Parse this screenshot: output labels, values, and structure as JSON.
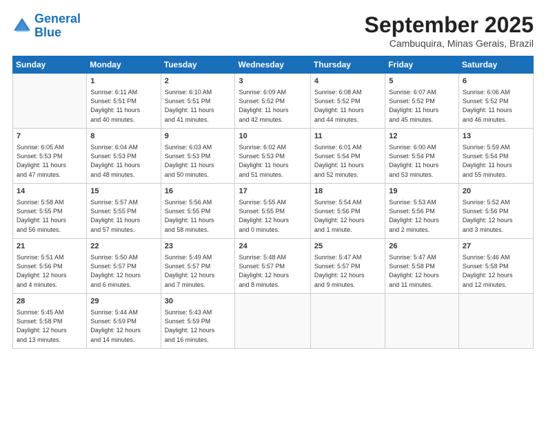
{
  "header": {
    "logo_line1": "General",
    "logo_line2": "Blue",
    "month_title": "September 2025",
    "location": "Cambuquira, Minas Gerais, Brazil"
  },
  "weekdays": [
    "Sunday",
    "Monday",
    "Tuesday",
    "Wednesday",
    "Thursday",
    "Friday",
    "Saturday"
  ],
  "weeks": [
    [
      {
        "day": "",
        "info": ""
      },
      {
        "day": "1",
        "info": "Sunrise: 6:11 AM\nSunset: 5:51 PM\nDaylight: 11 hours\nand 40 minutes."
      },
      {
        "day": "2",
        "info": "Sunrise: 6:10 AM\nSunset: 5:51 PM\nDaylight: 11 hours\nand 41 minutes."
      },
      {
        "day": "3",
        "info": "Sunrise: 6:09 AM\nSunset: 5:52 PM\nDaylight: 11 hours\nand 42 minutes."
      },
      {
        "day": "4",
        "info": "Sunrise: 6:08 AM\nSunset: 5:52 PM\nDaylight: 11 hours\nand 44 minutes."
      },
      {
        "day": "5",
        "info": "Sunrise: 6:07 AM\nSunset: 5:52 PM\nDaylight: 11 hours\nand 45 minutes."
      },
      {
        "day": "6",
        "info": "Sunrise: 6:06 AM\nSunset: 5:52 PM\nDaylight: 11 hours\nand 46 minutes."
      }
    ],
    [
      {
        "day": "7",
        "info": "Sunrise: 6:05 AM\nSunset: 5:53 PM\nDaylight: 11 hours\nand 47 minutes."
      },
      {
        "day": "8",
        "info": "Sunrise: 6:04 AM\nSunset: 5:53 PM\nDaylight: 11 hours\nand 48 minutes."
      },
      {
        "day": "9",
        "info": "Sunrise: 6:03 AM\nSunset: 5:53 PM\nDaylight: 11 hours\nand 50 minutes."
      },
      {
        "day": "10",
        "info": "Sunrise: 6:02 AM\nSunset: 5:53 PM\nDaylight: 11 hours\nand 51 minutes."
      },
      {
        "day": "11",
        "info": "Sunrise: 6:01 AM\nSunset: 5:54 PM\nDaylight: 11 hours\nand 52 minutes."
      },
      {
        "day": "12",
        "info": "Sunrise: 6:00 AM\nSunset: 5:54 PM\nDaylight: 11 hours\nand 53 minutes."
      },
      {
        "day": "13",
        "info": "Sunrise: 5:59 AM\nSunset: 5:54 PM\nDaylight: 11 hours\nand 55 minutes."
      }
    ],
    [
      {
        "day": "14",
        "info": "Sunrise: 5:58 AM\nSunset: 5:55 PM\nDaylight: 11 hours\nand 56 minutes."
      },
      {
        "day": "15",
        "info": "Sunrise: 5:57 AM\nSunset: 5:55 PM\nDaylight: 11 hours\nand 57 minutes."
      },
      {
        "day": "16",
        "info": "Sunrise: 5:56 AM\nSunset: 5:55 PM\nDaylight: 11 hours\nand 58 minutes."
      },
      {
        "day": "17",
        "info": "Sunrise: 5:55 AM\nSunset: 5:55 PM\nDaylight: 12 hours\nand 0 minutes."
      },
      {
        "day": "18",
        "info": "Sunrise: 5:54 AM\nSunset: 5:56 PM\nDaylight: 12 hours\nand 1 minute."
      },
      {
        "day": "19",
        "info": "Sunrise: 5:53 AM\nSunset: 5:56 PM\nDaylight: 12 hours\nand 2 minutes."
      },
      {
        "day": "20",
        "info": "Sunrise: 5:52 AM\nSunset: 5:56 PM\nDaylight: 12 hours\nand 3 minutes."
      }
    ],
    [
      {
        "day": "21",
        "info": "Sunrise: 5:51 AM\nSunset: 5:56 PM\nDaylight: 12 hours\nand 4 minutes."
      },
      {
        "day": "22",
        "info": "Sunrise: 5:50 AM\nSunset: 5:57 PM\nDaylight: 12 hours\nand 6 minutes."
      },
      {
        "day": "23",
        "info": "Sunrise: 5:49 AM\nSunset: 5:57 PM\nDaylight: 12 hours\nand 7 minutes."
      },
      {
        "day": "24",
        "info": "Sunrise: 5:48 AM\nSunset: 5:57 PM\nDaylight: 12 hours\nand 8 minutes."
      },
      {
        "day": "25",
        "info": "Sunrise: 5:47 AM\nSunset: 5:57 PM\nDaylight: 12 hours\nand 9 minutes."
      },
      {
        "day": "26",
        "info": "Sunrise: 5:47 AM\nSunset: 5:58 PM\nDaylight: 12 hours\nand 11 minutes."
      },
      {
        "day": "27",
        "info": "Sunrise: 5:46 AM\nSunset: 5:58 PM\nDaylight: 12 hours\nand 12 minutes."
      }
    ],
    [
      {
        "day": "28",
        "info": "Sunrise: 5:45 AM\nSunset: 5:58 PM\nDaylight: 12 hours\nand 13 minutes."
      },
      {
        "day": "29",
        "info": "Sunrise: 5:44 AM\nSunset: 5:59 PM\nDaylight: 12 hours\nand 14 minutes."
      },
      {
        "day": "30",
        "info": "Sunrise: 5:43 AM\nSunset: 5:59 PM\nDaylight: 12 hours\nand 16 minutes."
      },
      {
        "day": "",
        "info": ""
      },
      {
        "day": "",
        "info": ""
      },
      {
        "day": "",
        "info": ""
      },
      {
        "day": "",
        "info": ""
      }
    ]
  ]
}
